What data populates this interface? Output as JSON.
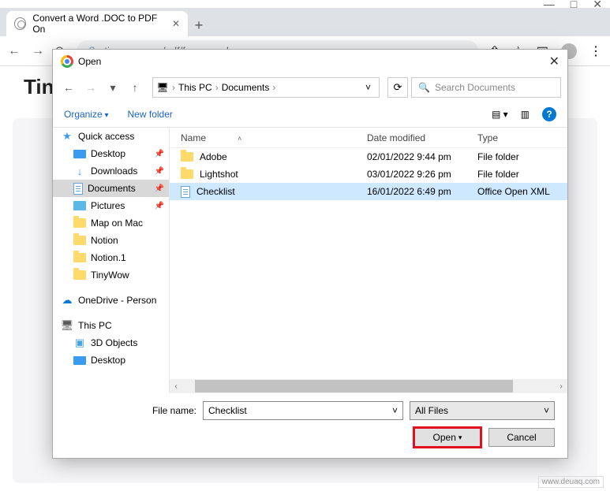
{
  "browser": {
    "tab_title": "Convert a Word .DOC to PDF On",
    "url": "tinywow.com/pdf/from-word",
    "window_buttons": [
      "—",
      "□",
      "✕"
    ]
  },
  "page": {
    "title_fragment": "Tin"
  },
  "dialog": {
    "title": "Open",
    "breadcrumb": {
      "root": "This PC",
      "folder": "Documents"
    },
    "search_placeholder": "Search Documents",
    "toolbar": {
      "organize": "Organize",
      "newfolder": "New folder"
    },
    "sidebar": {
      "quick_access": "Quick access",
      "items": [
        {
          "label": "Desktop",
          "icon": "desktop",
          "pinned": true
        },
        {
          "label": "Downloads",
          "icon": "download",
          "pinned": true
        },
        {
          "label": "Documents",
          "icon": "doc",
          "pinned": true,
          "selected": true
        },
        {
          "label": "Pictures",
          "icon": "pic",
          "pinned": true
        },
        {
          "label": "Map on Mac",
          "icon": "folder"
        },
        {
          "label": "Notion",
          "icon": "folder"
        },
        {
          "label": "Notion.1",
          "icon": "folder"
        },
        {
          "label": "TinyWow",
          "icon": "folder"
        }
      ],
      "onedrive": "OneDrive - Person",
      "thispc": "This PC",
      "pc_items": [
        {
          "label": "3D Objects",
          "icon": "3d"
        },
        {
          "label": "Desktop",
          "icon": "desktop"
        }
      ]
    },
    "columns": {
      "name": "Name",
      "date": "Date modified",
      "type": "Type"
    },
    "files": [
      {
        "name": "Adobe",
        "date": "02/01/2022 9:44 pm",
        "type": "File folder",
        "icon": "folder"
      },
      {
        "name": "Lightshot",
        "date": "03/01/2022 9:26 pm",
        "type": "File folder",
        "icon": "folder"
      },
      {
        "name": "Checklist",
        "date": "16/01/2022 6:49 pm",
        "type": "Office Open XML",
        "icon": "doc",
        "selected": true
      }
    ],
    "filename_label": "File name:",
    "filename_value": "Checklist",
    "filter": "All Files",
    "open_btn": "Open",
    "cancel_btn": "Cancel"
  },
  "watermark": "www.deuaq.com"
}
